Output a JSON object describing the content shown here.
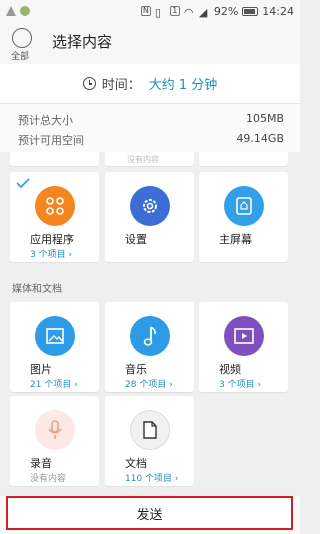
{
  "status_bar": {
    "battery": "92%",
    "time": "14:24"
  },
  "header": {
    "select_all_label": "全部",
    "title": "选择内容"
  },
  "time_card": {
    "label": "时间：",
    "value": "大约 1 分钟"
  },
  "size_info": {
    "total_label": "预计总大小",
    "total_value": "105MB",
    "space_label": "预计可用空间",
    "space_value": "49.14GB"
  },
  "partial_row": {
    "faded_text": "没有内容"
  },
  "apps": [
    {
      "label": "应用程序",
      "count": "3 个项目 ›",
      "selected": true,
      "icon": "apps-icon",
      "color": "#f5861f"
    },
    {
      "label": "设置",
      "count": "",
      "selected": false,
      "icon": "gear-icon",
      "color": "#3b6fd6"
    },
    {
      "label": "主屏幕",
      "count": "",
      "selected": false,
      "icon": "home-screen-icon",
      "color": "#31a0e8"
    }
  ],
  "section_media": "媒体和文档",
  "media": [
    {
      "label": "图片",
      "count": "21 个项目 ›",
      "icon": "image-icon",
      "color": "#2d9be6"
    },
    {
      "label": "音乐",
      "count": "28 个项目 ›",
      "icon": "music-icon",
      "color": "#2d9be6"
    },
    {
      "label": "视频",
      "count": "3 个项目 ›",
      "icon": "video-icon",
      "color": "#7f4fc0"
    },
    {
      "label": "录音",
      "count": "没有内容",
      "icon": "microphone-icon",
      "color": "#fce9e4",
      "empty": true
    },
    {
      "label": "文档",
      "count": "110 个项目 ›",
      "icon": "document-icon",
      "color": "#f5f5f5"
    }
  ],
  "bottom": {
    "send_label": "发送"
  }
}
